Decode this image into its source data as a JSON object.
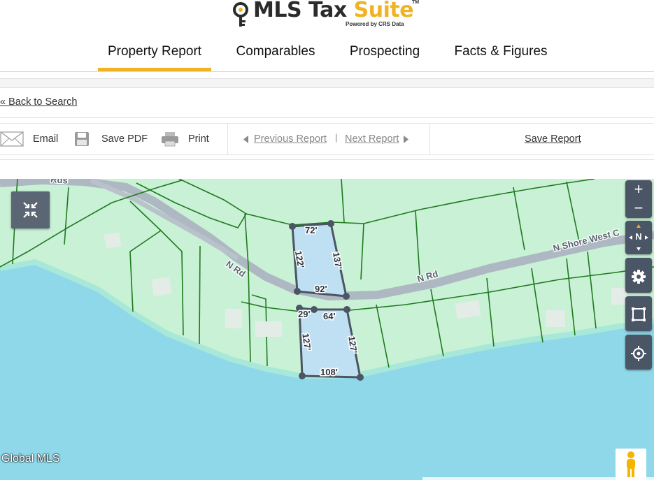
{
  "brand": {
    "name_part1": "MLS Tax ",
    "name_part2": "Suite",
    "trademark": "TM",
    "powered_by": "Powered by CRS Data",
    "colors": {
      "accent": "#f0b323",
      "dark": "#2b2b2b"
    }
  },
  "tabs": [
    {
      "label": "Property Report",
      "active": true
    },
    {
      "label": "Comparables",
      "active": false
    },
    {
      "label": "Prospecting",
      "active": false
    },
    {
      "label": "Facts & Figures",
      "active": false
    }
  ],
  "back_link": "« Back to Search",
  "toolbar": {
    "email": {
      "label": "Email",
      "icon": "envelope-icon"
    },
    "save_pdf": {
      "label": "Save PDF",
      "icon": "floppy-disk-icon"
    },
    "print": {
      "label": "Print",
      "icon": "printer-icon"
    },
    "previous": "Previous Report",
    "separator": "|",
    "next": "Next Report",
    "save_report": "Save Report"
  },
  "map": {
    "colors": {
      "water": "#8fd8ea",
      "land": "#c8f0d4",
      "parcel_line": "#1f7a1f",
      "road": "#aeb8c2",
      "selected": "#b9dcf0",
      "outline": "#4b5563",
      "control": "#4a5565"
    },
    "road_labels": [
      "N Rd",
      "N Rd",
      "N Shore West C"
    ],
    "top_road_label": "Rds",
    "parcel_upper": {
      "top": "72'",
      "left": "122'",
      "right": "137'",
      "bottom": "92'"
    },
    "parcel_lower": {
      "top_left": "29'",
      "top": "64'",
      "left": "127'",
      "right": "127'",
      "bottom": "108'"
    },
    "attribution": "Global MLS",
    "controls": {
      "zoom_in": "+",
      "zoom_out": "−",
      "compass": "N",
      "settings_icon": "gear-icon",
      "fullscreen_icon": "frame-icon",
      "locate_icon": "crosshair-icon",
      "collapse_icon": "collapse-arrows-icon",
      "streetview_icon": "pegman-icon"
    }
  }
}
